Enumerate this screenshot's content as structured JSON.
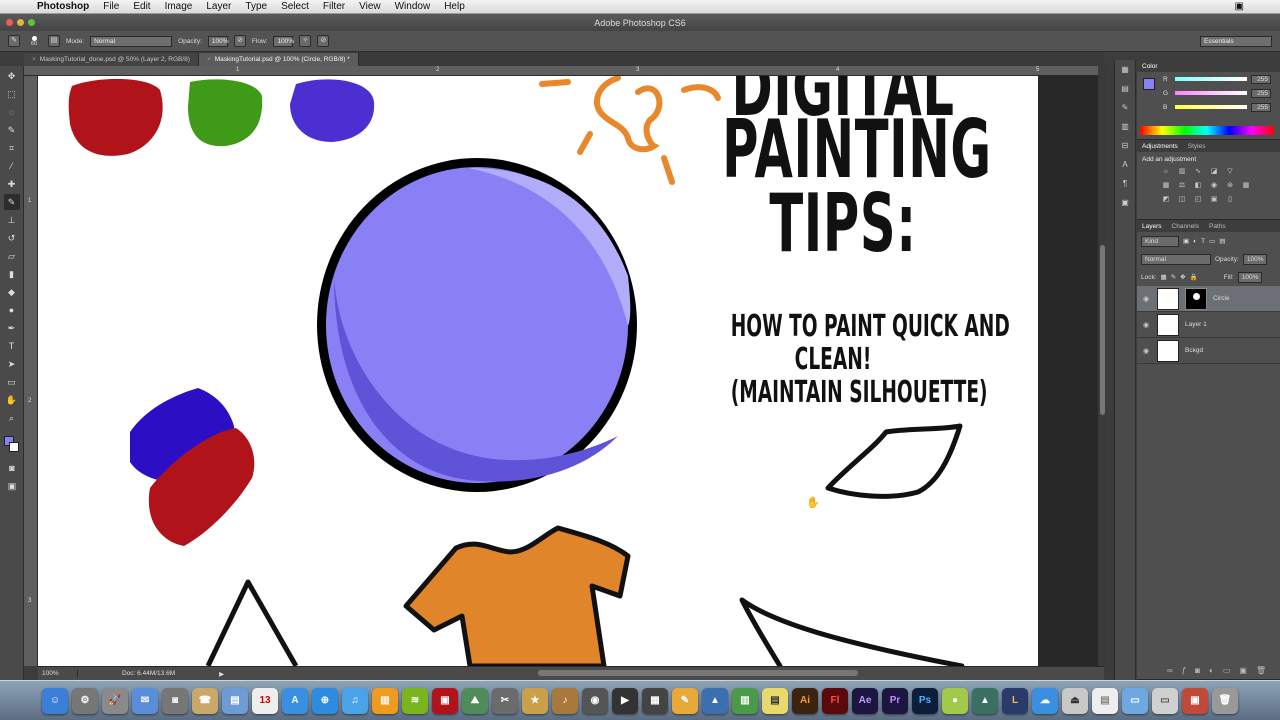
{
  "menubar": {
    "app_name": "Photoshop",
    "items": [
      "File",
      "Edit",
      "Image",
      "Layer",
      "Type",
      "Select",
      "Filter",
      "View",
      "Window",
      "Help"
    ]
  },
  "window": {
    "title": "Adobe Photoshop CS6"
  },
  "options": {
    "brush_size": "60",
    "mode_label": "Mode:",
    "mode_value": "Normal",
    "opacity_label": "Opacity:",
    "opacity_value": "100%",
    "flow_label": "Flow:",
    "flow_value": "100%",
    "workspace": "Essentials"
  },
  "tabs": [
    {
      "label": "MaskingTutorial_done.psd @ 50% (Layer 2, RGB/8)"
    },
    {
      "label": "MaskingTutorial.psd @ 100% (Circle, RGB/8) *"
    }
  ],
  "rulers": {
    "top": [
      "1",
      "2",
      "3",
      "4",
      "5"
    ],
    "left": [
      "1",
      "2",
      "3"
    ]
  },
  "canvas_text": {
    "headline_1": "DIGITAL",
    "headline_2": "PAINTING",
    "headline_3": "TIPS:",
    "sub_1": "HOW TO PAINT QUICK AND",
    "sub_2": "CLEAN!",
    "sub_3": "(MAINTAIN SILHOUETTE)"
  },
  "status": {
    "zoom": "100%",
    "doc": "Doc: 6.44M/13.6M"
  },
  "color_panel": {
    "title": "Color",
    "channels": [
      {
        "label": "R",
        "value": "255"
      },
      {
        "label": "G",
        "value": "255"
      },
      {
        "label": "B",
        "value": "255"
      }
    ]
  },
  "adjustments_panel": {
    "tabs": [
      "Adjustments",
      "Styles"
    ],
    "add_label": "Add an adjustment"
  },
  "layers_panel": {
    "tabs": [
      "Layers",
      "Channels",
      "Paths"
    ],
    "kind": "Kind",
    "blend_mode": "Normal",
    "opacity_label": "Opacity:",
    "opacity_value": "100%",
    "lock_label": "Lock:",
    "fill_label": "Fill:",
    "fill_value": "100%",
    "layers": [
      {
        "name": "Circle"
      },
      {
        "name": "Layer 1"
      },
      {
        "name": "Bckgd"
      }
    ]
  },
  "dock": {
    "apps": [
      "Ai",
      "Fl",
      "Ae",
      "Pr",
      "Ps"
    ]
  },
  "colors": {
    "red_blob": "#b0141a",
    "green_blob": "#3f9a17",
    "blue_blob": "#4c2fd0",
    "sun": "#e8882a",
    "circle_fill": "#8a80f6",
    "circle_shadow": "#5f54d8",
    "shirt": "#e0852a"
  }
}
